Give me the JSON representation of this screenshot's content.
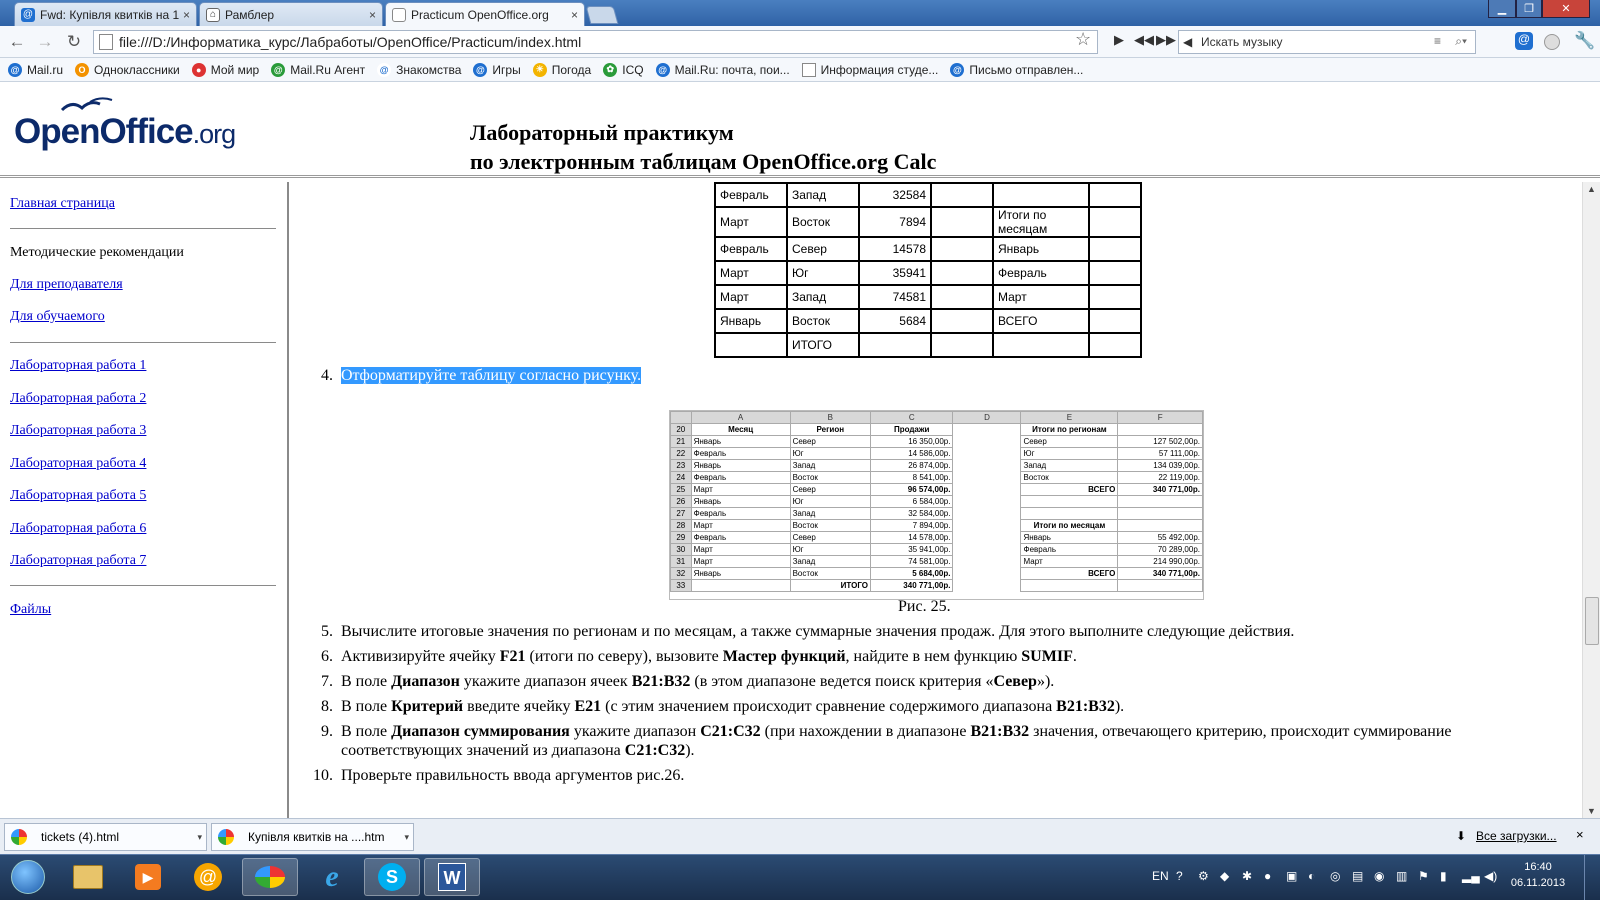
{
  "browser": {
    "tabs": [
      {
        "label": "Fwd: Купівля квитків на 1"
      },
      {
        "label": "Рамблер"
      },
      {
        "label": "Practicum OpenOffice.org"
      }
    ],
    "url": "file:///D:/Информатика_курс/Лабработы/OpenOffice/Practicum/index.html",
    "music_search_placeholder": "Искать музыку",
    "bookmarks": [
      {
        "label": "Mail.ru",
        "color": "#1f6fd0"
      },
      {
        "label": "Одноклассники",
        "color": "#f39200"
      },
      {
        "label": "Мой мир",
        "color": "#d33"
      },
      {
        "label": "Mail.Ru Агент",
        "color": "#2a9b3a"
      },
      {
        "label": "Знакомства",
        "color": "#1f6fd0"
      },
      {
        "label": "Игры",
        "color": "#1f6fd0"
      },
      {
        "label": "Погода",
        "color": "#f3b400"
      },
      {
        "label": "ICQ",
        "color": "#2a9b3a"
      },
      {
        "label": "Mail.Ru: почта, пои...",
        "color": "#1f6fd0"
      },
      {
        "label": "Информация студе...",
        "color": "#999"
      },
      {
        "label": "Письмо отправлен...",
        "color": "#1f6fd0"
      }
    ]
  },
  "header": {
    "logo_main": "OpenOffice",
    "logo_suffix": ".org",
    "title_line1": "Лабораторный практикум",
    "title_line2": "по электронным таблицам OpenOffice.org Calc"
  },
  "sidebar": {
    "home": "Главная страница",
    "method_heading": "Методические рекомендации",
    "for_teacher": "Для преподавателя",
    "for_student": "Для обучаемого",
    "labs": [
      "Лабораторная работа 1",
      "Лабораторная работа 2",
      "Лабораторная работа 3",
      "Лабораторная работа 4",
      "Лабораторная работа 5",
      "Лабораторная работа 6",
      "Лабораторная работа 7"
    ],
    "files": "Файлы"
  },
  "table1": {
    "rows": [
      [
        "Февраль",
        "Запад",
        "32584",
        "",
        "",
        ""
      ],
      [
        "Март",
        "Восток",
        "7894",
        "",
        "Итоги по месяцам",
        ""
      ],
      [
        "Февраль",
        "Север",
        "14578",
        "",
        "Январь",
        ""
      ],
      [
        "Март",
        "Юг",
        "35941",
        "",
        "Февраль",
        ""
      ],
      [
        "Март",
        "Запад",
        "74581",
        "",
        "Март",
        ""
      ],
      [
        "Январь",
        "Восток",
        "5684",
        "",
        "ВСЕГО",
        ""
      ],
      [
        "",
        "ИТОГО",
        "",
        "",
        "",
        ""
      ]
    ]
  },
  "step4": {
    "num": "4.",
    "text": "Отформатируйте таблицу согласно рисунку."
  },
  "figure": {
    "col_headers": [
      "A",
      "B",
      "C",
      "D",
      "E",
      "F"
    ],
    "rows": [
      {
        "n": "20",
        "a": "Месяц",
        "b": "Регион",
        "c": "Продажи",
        "d": "",
        "e": "Итоги по регионам",
        "f": ""
      },
      {
        "n": "21",
        "a": "Январь",
        "b": "Север",
        "c": "16 350,00р.",
        "d": "",
        "e": "Север",
        "f": "127 502,00р."
      },
      {
        "n": "22",
        "a": "Февраль",
        "b": "Юг",
        "c": "14 586,00р.",
        "d": "",
        "e": "Юг",
        "f": "57 111,00р."
      },
      {
        "n": "23",
        "a": "Январь",
        "b": "Запад",
        "c": "26 874,00р.",
        "d": "",
        "e": "Запад",
        "f": "134 039,00р."
      },
      {
        "n": "24",
        "a": "Февраль",
        "b": "Восток",
        "c": "8 541,00р.",
        "d": "",
        "e": "Восток",
        "f": "22 119,00р."
      },
      {
        "n": "25",
        "a": "Март",
        "b": "Север",
        "c": "96 574,00р.",
        "d": "",
        "e": "ВСЕГО",
        "f": "340 771,00р."
      },
      {
        "n": "26",
        "a": "Январь",
        "b": "Юг",
        "c": "6 584,00р.",
        "d": "",
        "e": "",
        "f": ""
      },
      {
        "n": "27",
        "a": "Февраль",
        "b": "Запад",
        "c": "32 584,00р.",
        "d": "",
        "e": "",
        "f": ""
      },
      {
        "n": "28",
        "a": "Март",
        "b": "Восток",
        "c": "7 894,00р.",
        "d": "",
        "e": "Итоги по месяцам",
        "f": ""
      },
      {
        "n": "29",
        "a": "Февраль",
        "b": "Север",
        "c": "14 578,00р.",
        "d": "",
        "e": "Январь",
        "f": "55 492,00р."
      },
      {
        "n": "30",
        "a": "Март",
        "b": "Юг",
        "c": "35 941,00р.",
        "d": "",
        "e": "Февраль",
        "f": "70 289,00р."
      },
      {
        "n": "31",
        "a": "Март",
        "b": "Запад",
        "c": "74 581,00р.",
        "d": "",
        "e": "Март",
        "f": "214 990,00р."
      },
      {
        "n": "32",
        "a": "Январь",
        "b": "Восток",
        "c": "5 684,00р.",
        "d": "",
        "e": "ВСЕГО",
        "f": "340 771,00р."
      },
      {
        "n": "33",
        "a": "",
        "b": "ИТОГО",
        "c": "340 771,00р.",
        "d": "",
        "e": "",
        "f": ""
      }
    ],
    "caption": "Рис. 25."
  },
  "steps": [
    {
      "num": "5.",
      "html": "Вычислите итоговые значения по регионам и по месяцам, а также суммарные значения продаж. Для этого выполните следующие действия."
    },
    {
      "num": "6.",
      "html": "Активизируйте ячейку <b>F21</b> (итоги по северу), вызовите <b>Мастер функций</b>, найдите в нем функцию <b>SUMIF</b>."
    },
    {
      "num": "7.",
      "html": "В поле <b>Диапазон</b> укажите диапазон ячеек <b>B21:B32</b> (в этом диапазоне ведется поиск критерия «<b>Север</b>»)."
    },
    {
      "num": "8.",
      "html": "В поле <b>Критерий</b> введите ячейку <b>E21</b> (с этим значением происходит сравнение содержимого диапазона <b>B21:B32</b>)."
    },
    {
      "num": "9.",
      "html": "В поле <b>Диапазон суммирования</b> укажите диапазон <b>C21:C32</b> (при нахождении в диапазоне <b>B21:B32</b> значения, отвечающего критерию, происходит суммирование соответствующих значений из диапазона <b>C21:C32</b>)."
    },
    {
      "num": "10.",
      "html": "Проверьте правильность ввода аргументов рис.26."
    }
  ],
  "downloads": {
    "items": [
      "tickets (4).html",
      "Купівля квитків на ....htm"
    ],
    "all": "Все загрузки..."
  },
  "taskbar": {
    "lang": "EN",
    "time": "16:40",
    "date": "06.11.2013"
  }
}
